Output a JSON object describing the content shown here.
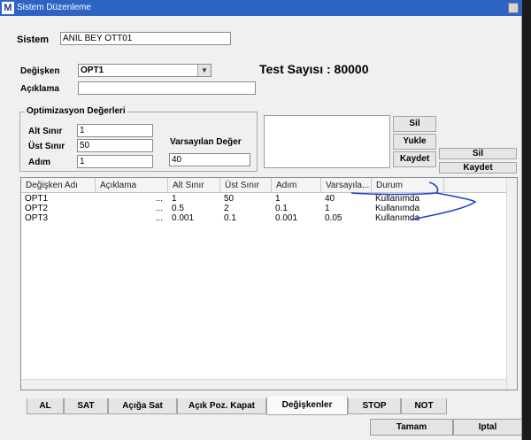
{
  "window": {
    "title": "Sistem Düzenleme",
    "app_icon_letter": "M"
  },
  "sistem": {
    "label": "Sistem",
    "value": "ANIL BEY OTT01"
  },
  "degisken": {
    "label": "Değişken",
    "value": "OPT1"
  },
  "aciklama": {
    "label": "Açıklama",
    "value": ""
  },
  "test_sayisi": "Test Sayısı : 80000",
  "optimizasyon": {
    "title": "Optimizasyon Değerleri",
    "alt_sinir_label": "Alt Sınır",
    "alt_sinir_value": "1",
    "ust_sinir_label": "Üst Sınır",
    "ust_sinir_value": "50",
    "adim_label": "Adım",
    "adim_value": "1",
    "varsayilan_label": "Varsayılan Değer",
    "varsayilan_value": "40"
  },
  "list_buttons": {
    "sil": "Sil",
    "yukle": "Yukle",
    "kaydet": "Kaydet"
  },
  "right_buttons": {
    "sil": "Sil",
    "kaydet": "Kaydet"
  },
  "grid": {
    "columns": [
      "Değişken Adı",
      "Açıklama",
      "Alt Sınır",
      "Üst Sınır",
      "Adım",
      "Varsayıla...",
      "Durum"
    ],
    "rows": [
      [
        "OPT1",
        "...",
        "1",
        "50",
        "1",
        "40",
        "Kullanımda"
      ],
      [
        "OPT2",
        "...",
        "0.5",
        "2",
        "0.1",
        "1",
        "Kullanımda"
      ],
      [
        "OPT3",
        "...",
        "0.001",
        "0.1",
        "0.001",
        "0.05",
        "Kullanımda"
      ]
    ]
  },
  "tabs": [
    {
      "label": "AL",
      "active": false
    },
    {
      "label": "SAT",
      "active": false
    },
    {
      "label": "Açığa Sat",
      "active": false
    },
    {
      "label": "Açık Poz. Kapat",
      "active": false
    },
    {
      "label": "Değişkenler",
      "active": true
    },
    {
      "label": "STOP",
      "active": false
    },
    {
      "label": "NOT",
      "active": false
    }
  ],
  "footer": {
    "ok": "Tamam",
    "cancel": "Iptal"
  },
  "colors": {
    "titlebar": "#2d64c4",
    "annotation_ink": "#1f3fd6"
  }
}
